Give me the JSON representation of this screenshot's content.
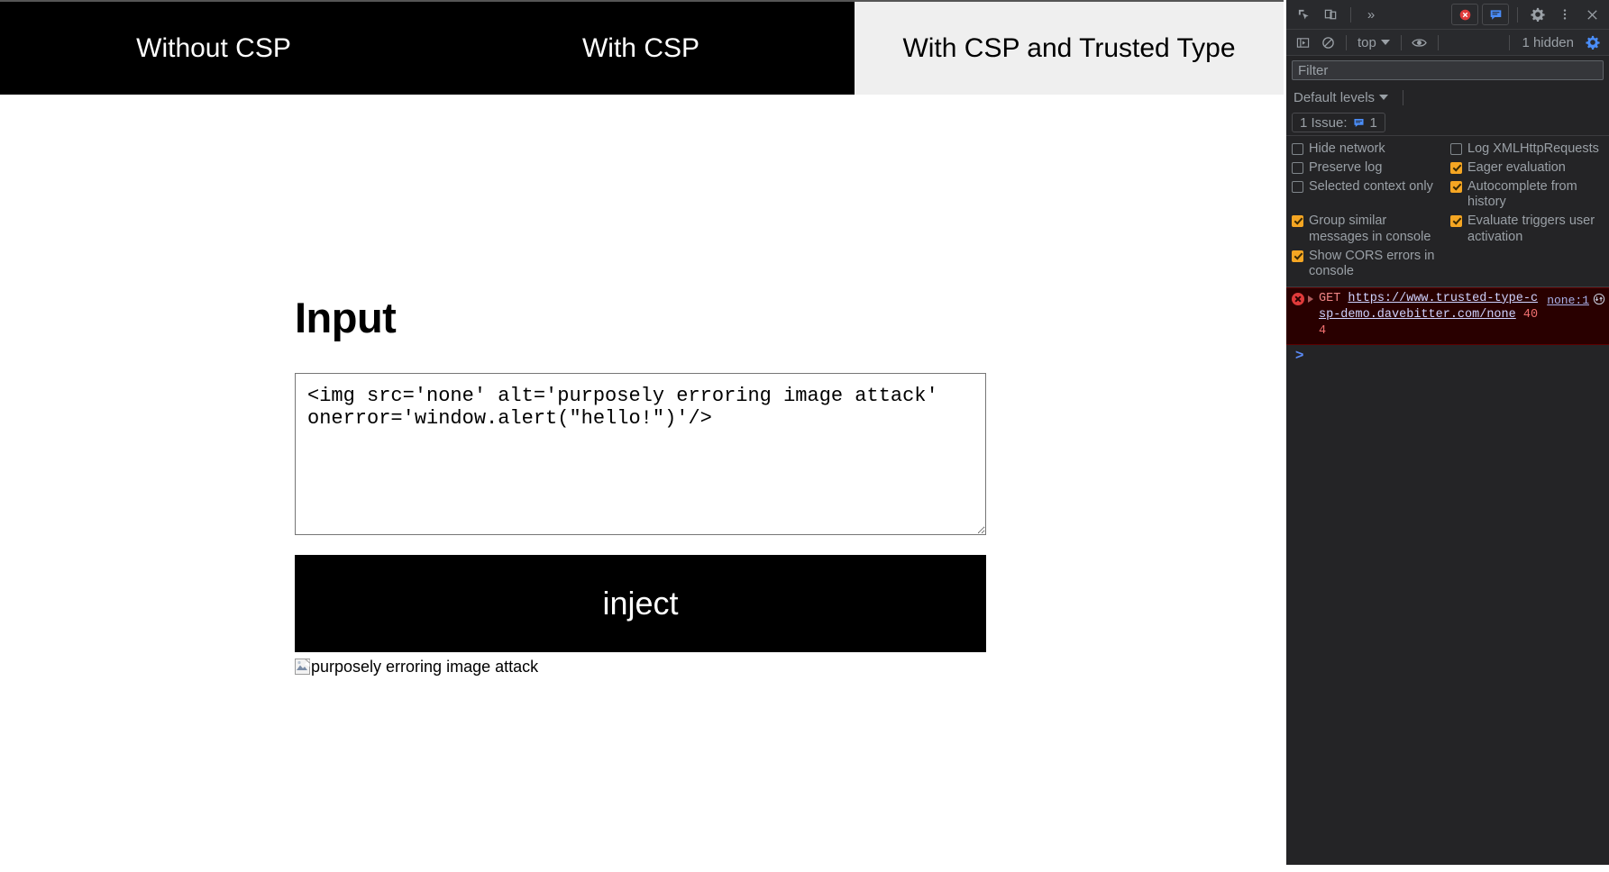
{
  "page": {
    "tabs": [
      {
        "label": "Without CSP",
        "active": false
      },
      {
        "label": "With CSP",
        "active": false
      },
      {
        "label": "With CSP and Trusted Type",
        "active": true
      }
    ],
    "heading": "Input",
    "textarea_value": "<img src='none' alt='purposely erroring image attack' onerror='window.alert(\"hello!\")'/>",
    "textarea_placeholder": "",
    "inject_label": "inject",
    "broken_image_alt": "purposely erroring image attack"
  },
  "devtools": {
    "topbar": {
      "inspect_icon": "inspect-element-icon",
      "device_icon": "device-toolbar-icon",
      "more_panels": "»",
      "error_count_icon": "error-badge-icon",
      "issues_icon": "issues-message-icon",
      "settings_icon": "gear-icon",
      "menu_icon": "kebab-menu-icon",
      "close_icon": "close-icon"
    },
    "console_toolbar": {
      "sidebar_icon": "console-sidebar-icon",
      "clear_icon": "clear-console-icon",
      "context": "top",
      "eye_icon": "live-expression-eye-icon",
      "hidden_text": "1 hidden",
      "settings_icon": "console-settings-gear-icon"
    },
    "filter": {
      "placeholder": "Filter",
      "value": ""
    },
    "levels": {
      "label": "Default levels"
    },
    "issues": {
      "prefix": "1 Issue:",
      "icon": "issues-badge-icon",
      "count": "1"
    },
    "settings": [
      {
        "label": "Hide network",
        "checked": false
      },
      {
        "label": "Log XMLHttpRequests",
        "checked": false
      },
      {
        "label": "Preserve log",
        "checked": false
      },
      {
        "label": "Eager evaluation",
        "checked": true
      },
      {
        "label": "Selected context only",
        "checked": false
      },
      {
        "label": "Autocomplete from history",
        "checked": true
      },
      {
        "label": "Group similar messages in console",
        "checked": true
      },
      {
        "label": "Evaluate triggers user activation",
        "checked": true
      },
      {
        "label": "Show CORS errors in console",
        "checked": true
      }
    ],
    "console_entries": [
      {
        "severity": "error",
        "method": "GET",
        "url": "https://www.trusted-type-csp-demo.davebitter.com/none",
        "status": "404",
        "source": "none:1",
        "source_icon": "network-request-icon"
      }
    ],
    "prompt": ">"
  },
  "colors": {
    "devtools_bg": "#242426",
    "devtools_toolbar_bg": "#292a2d",
    "error_bg": "#290000",
    "checkbox_on": "#f5a623",
    "accent_blue": "#5b8bf7",
    "error_red": "#e03b3b",
    "active_tab_bg": "#efefef",
    "tab_bg": "#000000"
  }
}
